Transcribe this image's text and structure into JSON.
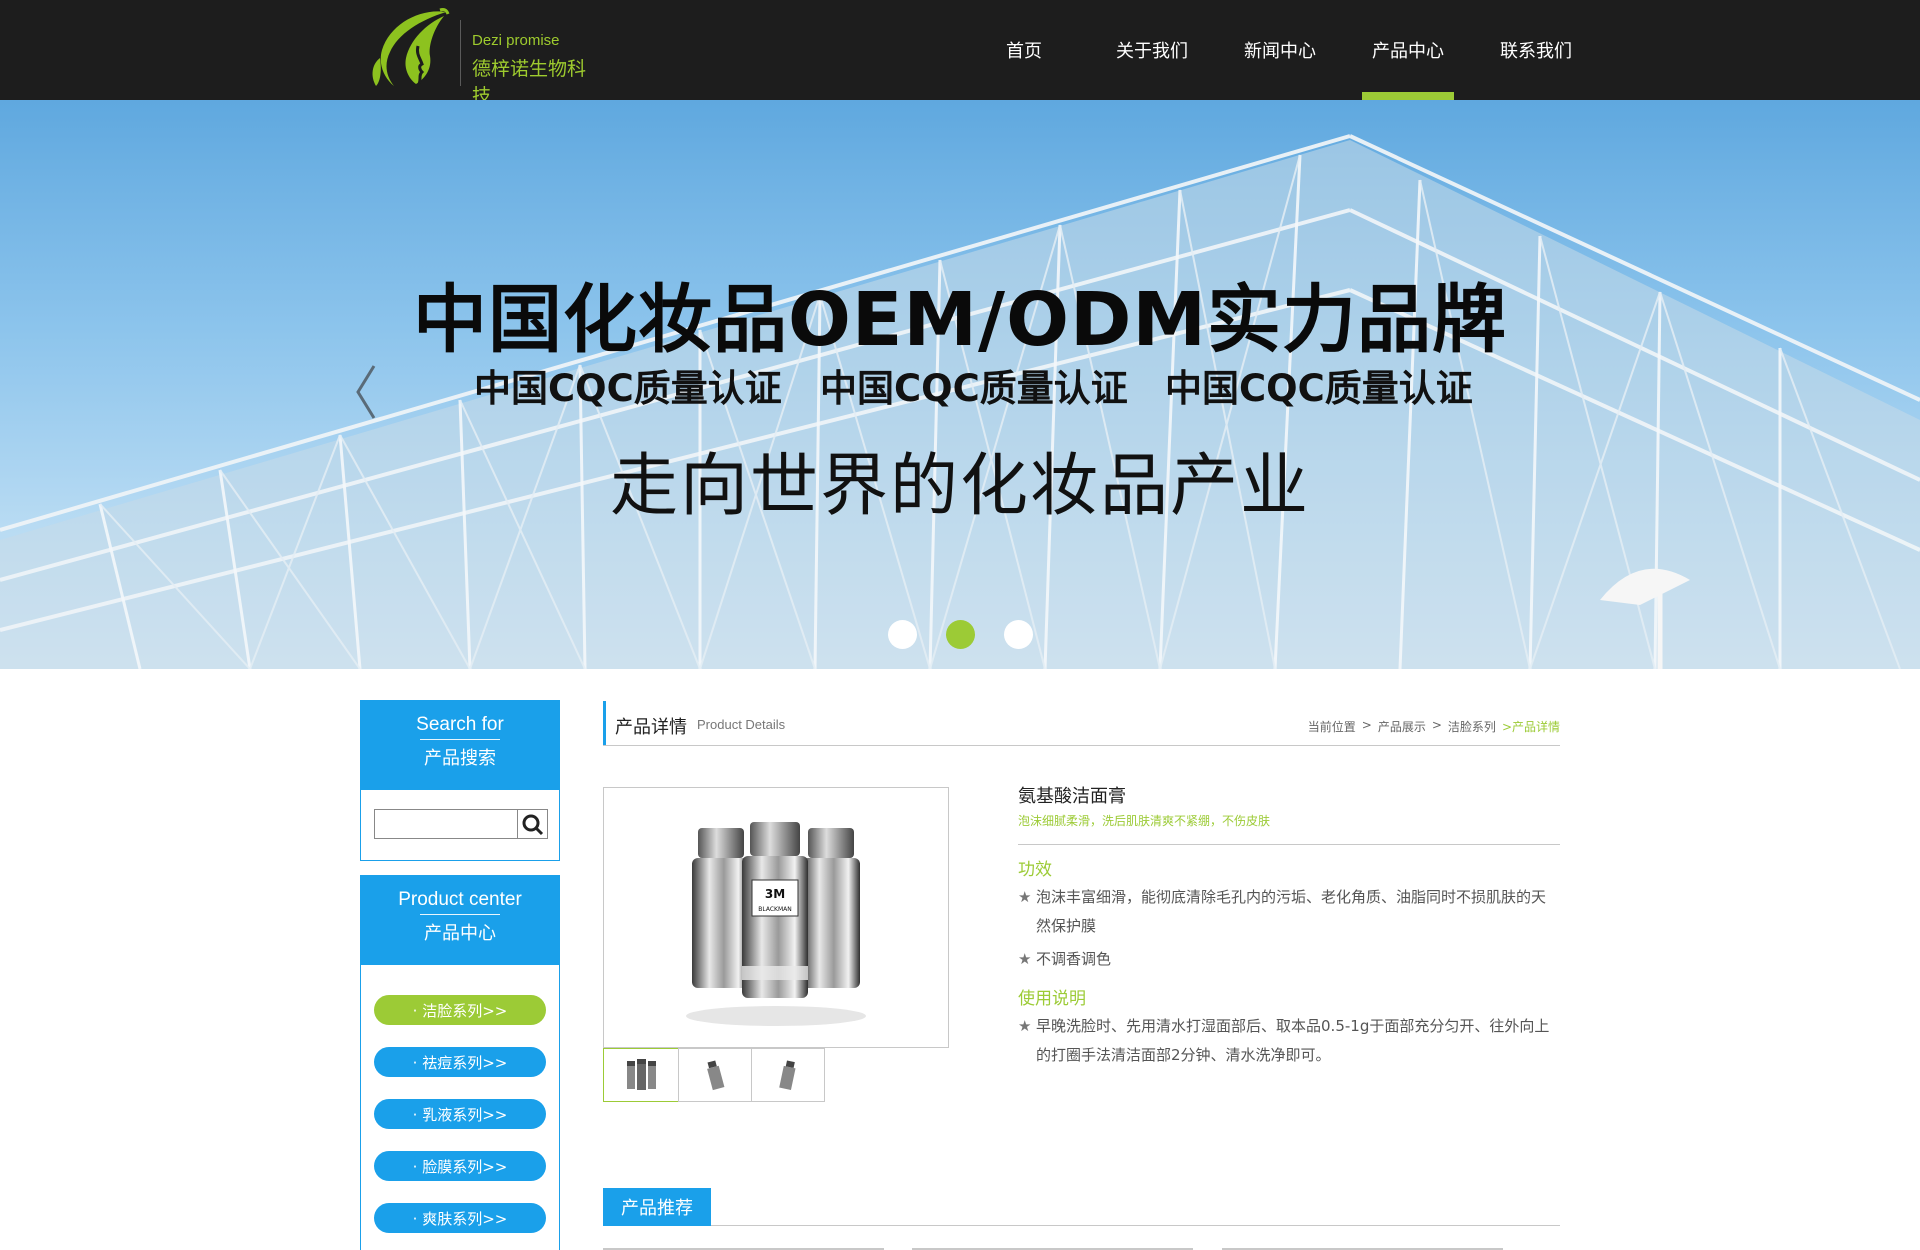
{
  "brand": {
    "name_en": "Dezi promise",
    "name_cn": "德梓诺生物科技",
    "color": "#9ccb36"
  },
  "nav": {
    "items": [
      "首页",
      "关于我们",
      "新闻中心",
      "产品中心",
      "联系我们"
    ],
    "active_index": 3
  },
  "banner": {
    "headline": "中国化妆品OEM/ODM实力品牌",
    "subs": [
      "中国CQC质量认证",
      "中国CQC质量认证",
      "中国CQC质量认证"
    ],
    "tagline": "走向世界的化妆品产业",
    "prev_icon": "chevron-left-icon",
    "dot_count": 3,
    "active_dot": 1
  },
  "sidebar": {
    "search": {
      "title_en": "Search for",
      "title_cn": "产品搜索",
      "placeholder": "",
      "button_icon": "search-icon"
    },
    "products": {
      "title_en": "Product center",
      "title_cn": "产品中心"
    },
    "categories": [
      "· 洁脸系列>>",
      "· 祛痘系列>>",
      "· 乳液系列>>",
      "· 脸膜系列>>",
      "· 爽肤系列>>"
    ],
    "active_category": 0
  },
  "detail": {
    "title_cn": "产品详情",
    "title_en": "Product Details",
    "breadcrumb": [
      "当前位置",
      ">",
      "产品展示",
      ">",
      "洁脸系列",
      ">产品详情"
    ],
    "product_name": "氨基酸洁面膏",
    "slogan": "泡沫细腻柔滑，洗后肌肤清爽不紧绷，不伤皮肤",
    "effect_title": "功效",
    "effect_items": [
      "泡沫丰富细滑，能彻底清除毛孔内的污垢、老化角质、油脂同时不损肌肤的天然保护膜",
      "不调香调色"
    ],
    "usage_title": "使用说明",
    "usage_items": [
      "早晚洗脸时、先用清水打湿面部后、取本品0.5-1g于面部充分匀开、往外向上的打圈手法清洁面部2分钟、清水洗净即可。"
    ],
    "bottle_label": "3M",
    "bottle_brand": "BLACKMAN",
    "thumb_count": 3,
    "active_thumb": 0
  },
  "recommend": {
    "title": "产品推荐"
  },
  "colors": {
    "header_bg": "#1d1d1d",
    "accent_blue": "#1aa0ea",
    "accent_green": "#9ccb36"
  }
}
